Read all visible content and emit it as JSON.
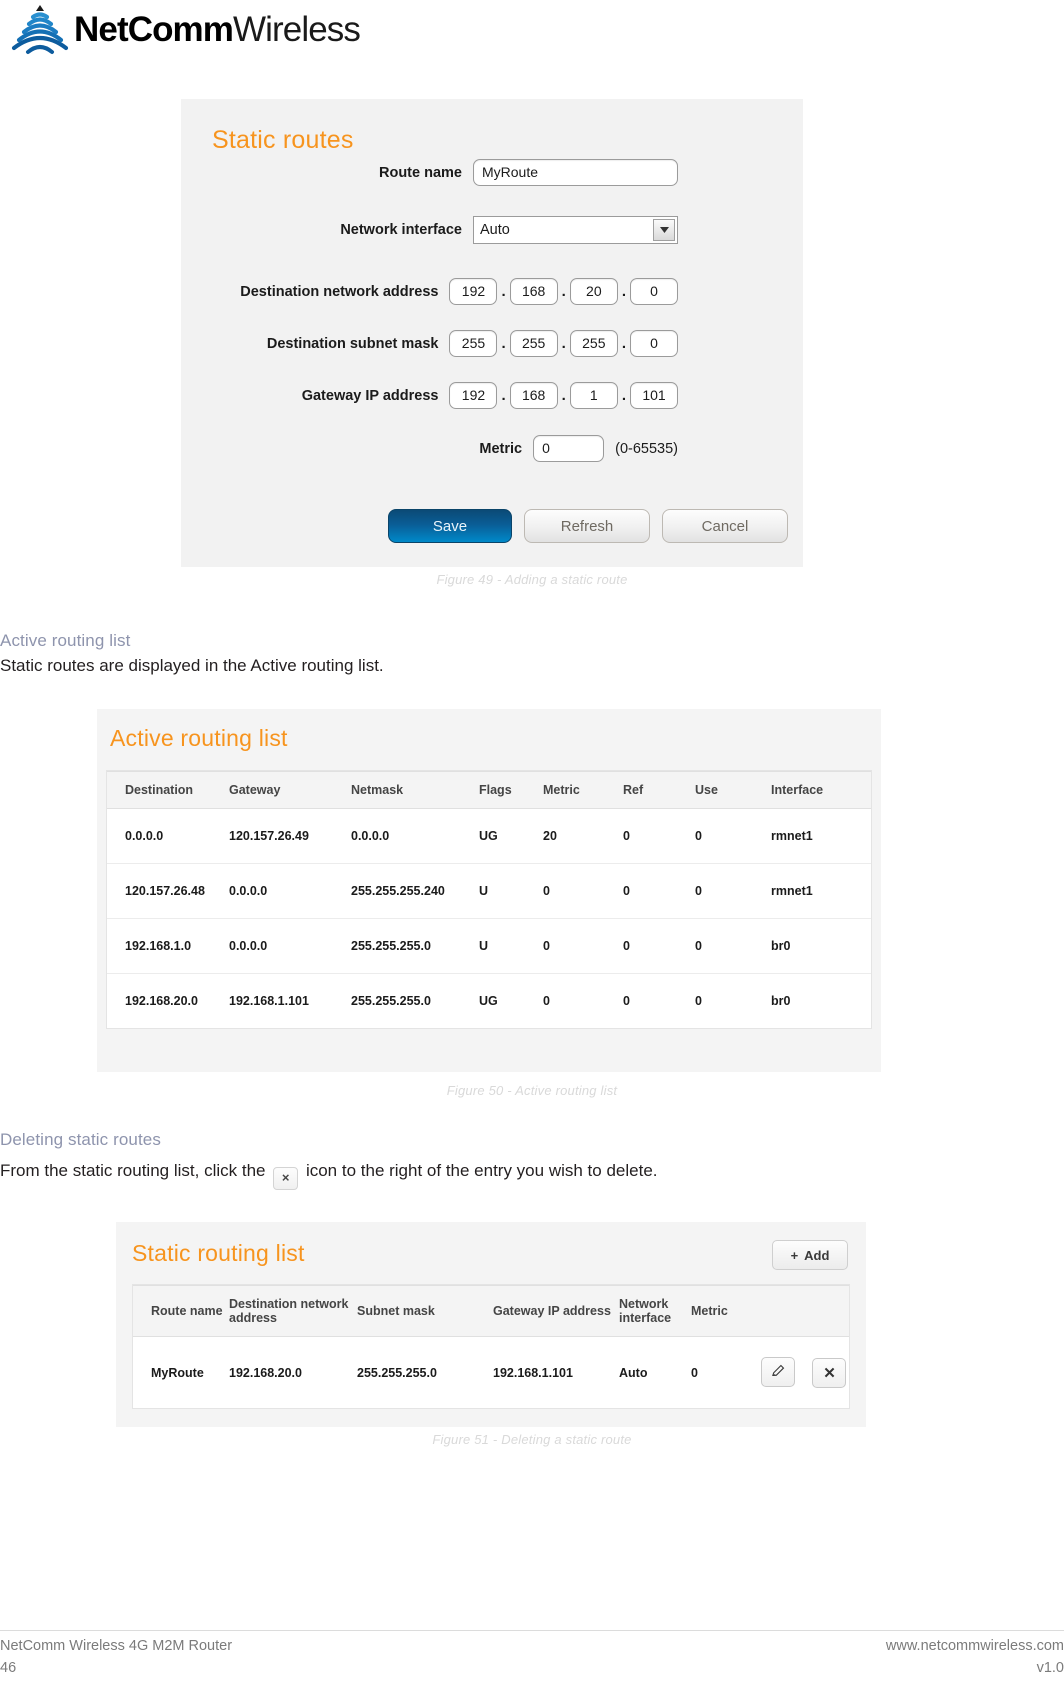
{
  "brand": {
    "name_bold": "NetComm",
    "name_light": "Wireless",
    "logo_icon": "netcomm-wave-logo"
  },
  "figure49": {
    "panel_title": "Static routes",
    "fields": {
      "route_name_label": "Route name",
      "route_name_value": "MyRoute",
      "network_interface_label": "Network interface",
      "network_interface_value": "Auto",
      "destination_network_label": "Destination network address",
      "destination_network_octets": [
        "192",
        "168",
        "20",
        "0"
      ],
      "destination_subnet_label": "Destination subnet mask",
      "destination_subnet_octets": [
        "255",
        "255",
        "255",
        "0"
      ],
      "gateway_label": "Gateway IP address",
      "gateway_octets": [
        "192",
        "168",
        "1",
        "101"
      ],
      "metric_label": "Metric",
      "metric_value": "0",
      "metric_hint": "(0-65535)"
    },
    "buttons": {
      "save": "Save",
      "refresh": "Refresh",
      "cancel": "Cancel"
    },
    "caption": "Figure 49 - Adding a static route"
  },
  "section_active": {
    "heading": "Active routing list",
    "body": "Static routes are displayed in the Active routing list."
  },
  "figure50": {
    "panel_title": "Active routing list",
    "columns": [
      "Destination",
      "Gateway",
      "Netmask",
      "Flags",
      "Metric",
      "Ref",
      "Use",
      "Interface"
    ],
    "rows": [
      [
        "0.0.0.0",
        "120.157.26.49",
        "0.0.0.0",
        "UG",
        "20",
        "0",
        "0",
        "rmnet1"
      ],
      [
        "120.157.26.48",
        "0.0.0.0",
        "255.255.255.240",
        "U",
        "0",
        "0",
        "0",
        "rmnet1"
      ],
      [
        "192.168.1.0",
        "0.0.0.0",
        "255.255.255.0",
        "U",
        "0",
        "0",
        "0",
        "br0"
      ],
      [
        "192.168.20.0",
        "192.168.1.101",
        "255.255.255.0",
        "UG",
        "0",
        "0",
        "0",
        "br0"
      ]
    ],
    "caption": "Figure 50 - Active routing list"
  },
  "section_delete": {
    "heading": "Deleting static routes",
    "body_before": "From the static routing list, click the",
    "inline_icon": "×",
    "inline_icon_name": "delete-x-icon",
    "body_after": "icon to the right of the entry you wish to delete."
  },
  "figure51": {
    "panel_title": "Static routing list",
    "add_button": "Add",
    "add_icon": "plus-icon",
    "columns": [
      "Route name",
      "Destination network address",
      "Subnet mask",
      "Gateway IP address",
      "Network interface",
      "Metric"
    ],
    "rows": [
      {
        "route_name": "MyRoute",
        "destination": "192.168.20.0",
        "subnet": "255.255.255.0",
        "gateway": "192.168.1.101",
        "interface": "Auto",
        "metric": "0",
        "edit_icon": "pencil-icon",
        "delete_icon": "close-x-icon"
      }
    ],
    "caption": "Figure 51 - Deleting a static route"
  },
  "footer": {
    "product": "NetComm Wireless 4G M2M Router",
    "page_number": "46",
    "website": "www.netcommwireless.com",
    "version": "v1.0"
  },
  "colors": {
    "accent_orange": "#f7941e",
    "heading_blue_grey": "#8e94ad",
    "primary_button": "#0a5d96",
    "logo_blue": "#1b75bb"
  }
}
